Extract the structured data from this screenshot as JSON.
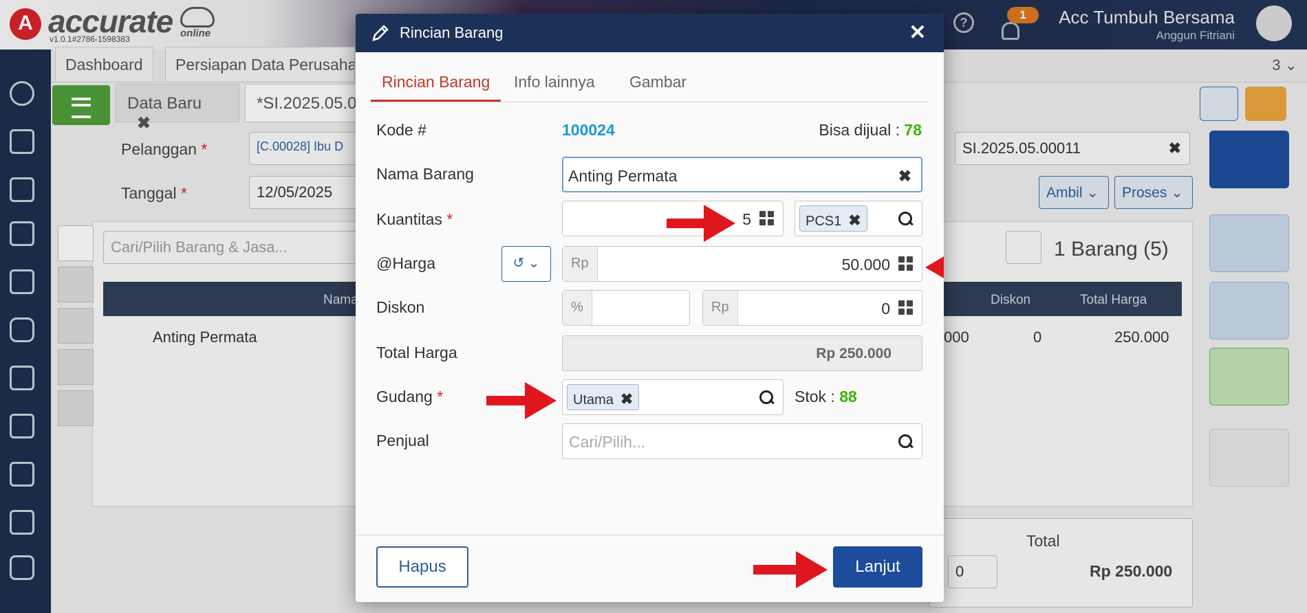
{
  "app": {
    "logo_letter": "A",
    "logo_text": "accurate",
    "logo_sub": "online",
    "version": "v1.0.1#2786-1598383",
    "notif_count": "1",
    "help_glyph": "?",
    "company": "Acc Tumbuh Bersama",
    "user": "Anggun Fitriani"
  },
  "tabs": {
    "dashboard": "Dashboard",
    "persiapan": "Persiapan Data Perusaha",
    "count": "3 ⌄",
    "data_baru": "Data Baru",
    "data_baru_close": "✖",
    "si": "*SI.2025.05.00"
  },
  "form_bg": {
    "pelanggan_label": "Pelanggan",
    "pelanggan_value": "[C.00028] Ibu D",
    "tanggal_label": "Tanggal",
    "tanggal_value": "12/05/2025",
    "required_mark": "*",
    "no_value": "SI.2025.05.00011",
    "no_clear": "✖",
    "ambil_label": "Ambil ⌄",
    "proses_label": "Proses ⌄",
    "search_placeholder": "Cari/Pilih Barang & Jasa...",
    "barang_count": "1 Barang (5)",
    "col_nama": "Nama",
    "col_diskon": "Diskon",
    "col_total": "Total Harga",
    "row_name": "Anting Permata",
    "row_harga_partial": "000",
    "row_diskon": "0",
    "row_total": "250.000",
    "total_label": "Total",
    "total_value": "Rp 250.000",
    "footer_disc": "0"
  },
  "modal": {
    "title": "Rincian Barang",
    "close": "✕",
    "tabs": [
      "Rincian Barang",
      "Info lainnya",
      "Gambar"
    ],
    "kode_label": "Kode #",
    "kode_value": "100024",
    "bisa_dijual_label": "Bisa dijual :",
    "bisa_dijual_value": "78",
    "nama_label": "Nama Barang",
    "nama_value": "Anting Permata",
    "nama_clear": "✖",
    "kuantitas_label": "Kuantitas",
    "kuantitas_value": "5",
    "unit_chip": "PCS1",
    "chip_x": "✖",
    "harga_label": "@Harga",
    "harga_prefix": "Rp",
    "harga_value": "50.000",
    "history_glyph": "↺ ⌄",
    "diskon_label": "Diskon",
    "diskon_pct_prefix": "%",
    "diskon_pct_value": "",
    "diskon_rp_prefix": "Rp",
    "diskon_rp_value": "0",
    "total_label": "Total Harga",
    "total_value": "Rp 250.000",
    "gudang_label": "Gudang",
    "gudang_chip": "Utama",
    "stok_label": "Stok :",
    "stok_value": "88",
    "penjual_label": "Penjual",
    "penjual_placeholder": "Cari/Pilih...",
    "required_mark": "*",
    "hapus": "Hapus",
    "lanjut": "Lanjut"
  },
  "colors": {
    "header_bg": "#1c3157",
    "accent_red": "#c0392b",
    "link_blue": "#1a9ad6",
    "stock_green": "#3cb400",
    "primary_btn": "#1c4c9a",
    "arrow_red": "#e0161e"
  }
}
